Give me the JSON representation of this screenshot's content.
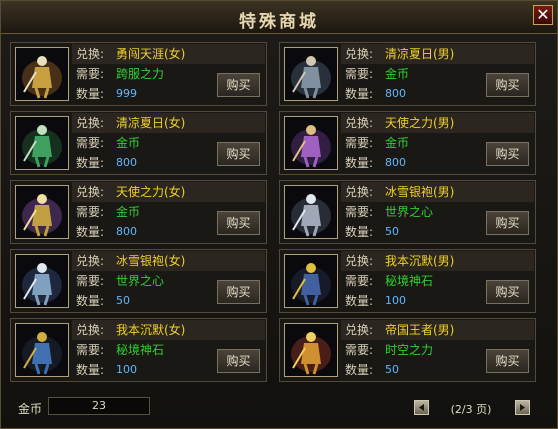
{
  "window": {
    "title": "特殊商城",
    "close_symbol": "✕"
  },
  "item_labels": {
    "exchange": "兑换:",
    "require": "需要:",
    "quantity": "数量:",
    "buy": "购买"
  },
  "items": [
    {
      "name": "勇闯天涯(女)",
      "require": "跨服之力",
      "quantity": "999",
      "icon": "warrior-female-gold-icon"
    },
    {
      "name": "清凉夏日(男)",
      "require": "金币",
      "quantity": "800",
      "icon": "summer-male-icon"
    },
    {
      "name": "清凉夏日(女)",
      "require": "金币",
      "quantity": "800",
      "icon": "summer-female-icon"
    },
    {
      "name": "天使之力(男)",
      "require": "金币",
      "quantity": "800",
      "icon": "angel-male-icon"
    },
    {
      "name": "天使之力(女)",
      "require": "金币",
      "quantity": "800",
      "icon": "angel-female-icon"
    },
    {
      "name": "冰雪银袍(男)",
      "require": "世界之心",
      "quantity": "50",
      "icon": "silver-robe-male-icon"
    },
    {
      "name": "冰雪银袍(女)",
      "require": "世界之心",
      "quantity": "50",
      "icon": "silver-robe-female-icon"
    },
    {
      "name": "我本沉默(男)",
      "require": "秘境神石",
      "quantity": "100",
      "icon": "silent-male-icon"
    },
    {
      "name": "我本沉默(女)",
      "require": "秘境神石",
      "quantity": "100",
      "icon": "silent-female-icon"
    },
    {
      "name": "帝国王者(男)",
      "require": "时空之力",
      "quantity": "50",
      "icon": "emperor-male-icon"
    }
  ],
  "footer": {
    "gold_label": "金币",
    "gold_value": "23",
    "page_info": "(2/3 页)"
  },
  "colors": {
    "name": "#f0d028",
    "require": "#30d030",
    "quantity": "#60b8ff"
  }
}
